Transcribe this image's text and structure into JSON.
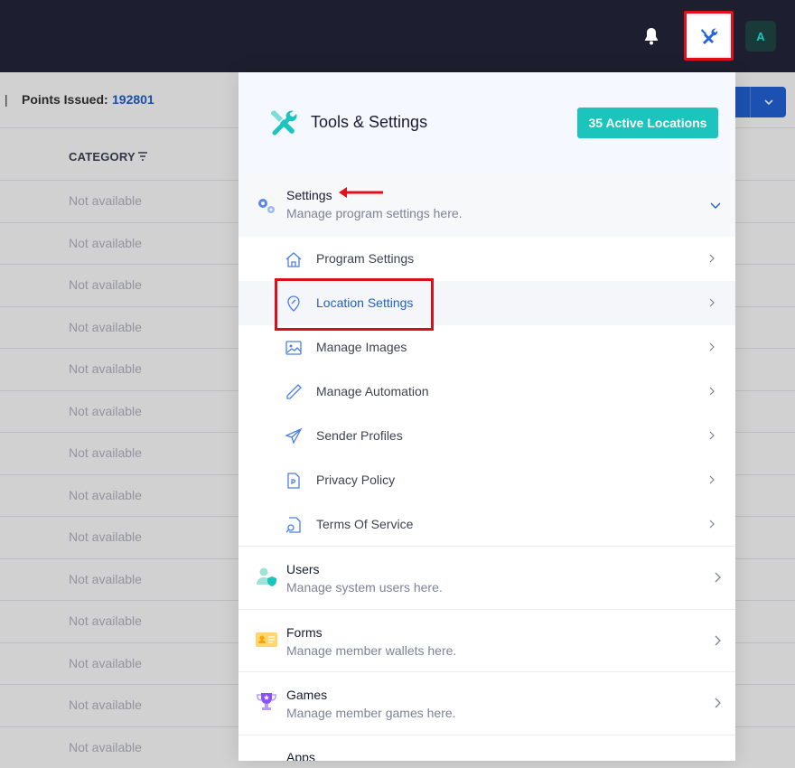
{
  "topbar": {
    "avatar_initial": "A"
  },
  "stats": {
    "separator": "|",
    "points_label": "Points Issued:",
    "points_value": "192801"
  },
  "table": {
    "category_header": "CATEGORY",
    "cells": [
      "Not available",
      "Not available",
      "Not available",
      "Not available",
      "Not available",
      "Not available",
      "Not available",
      "Not available",
      "Not available",
      "Not available",
      "Not available",
      "Not available",
      "Not available",
      "Not available"
    ]
  },
  "panel": {
    "title": "Tools & Settings",
    "badge": "35 Active Locations",
    "settings": {
      "title": "Settings",
      "subtitle": "Manage program settings here.",
      "items": [
        {
          "label": "Program Settings",
          "icon": "home-icon"
        },
        {
          "label": "Location Settings",
          "icon": "location-pin-icon"
        },
        {
          "label": "Manage Images",
          "icon": "image-icon"
        },
        {
          "label": "Manage Automation",
          "icon": "pen-icon"
        },
        {
          "label": "Sender Profiles",
          "icon": "paper-plane-icon"
        },
        {
          "label": "Privacy Policy",
          "icon": "document-icon"
        },
        {
          "label": "Terms Of Service",
          "icon": "document-search-icon"
        }
      ]
    },
    "sections": [
      {
        "title": "Users",
        "subtitle": "Manage system users here.",
        "icon": "user-shield-icon"
      },
      {
        "title": "Forms",
        "subtitle": "Manage member wallets here.",
        "icon": "id-card-icon"
      },
      {
        "title": "Games",
        "subtitle": "Manage member games here.",
        "icon": "trophy-icon"
      },
      {
        "title": "Apps",
        "subtitle": "",
        "icon": "apps-icon"
      }
    ]
  },
  "colors": {
    "topbar": "#1d1e2f",
    "accent": "#1bc5bd",
    "primary": "#1f61c9",
    "highlight": "#e0101c"
  }
}
